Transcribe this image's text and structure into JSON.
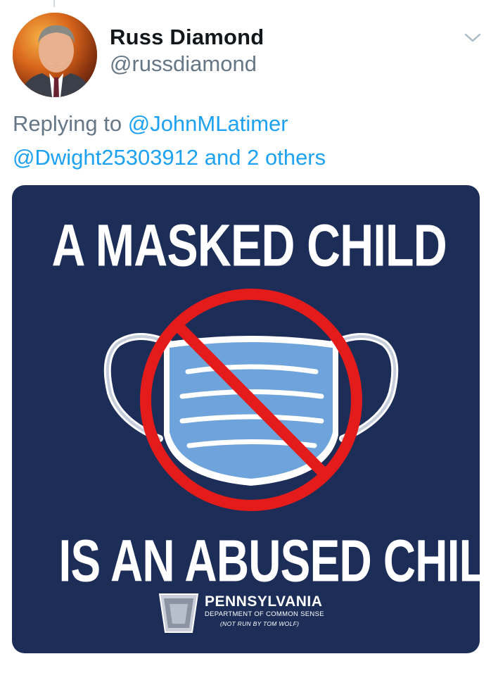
{
  "tweet": {
    "author": {
      "name": "Russ Diamond",
      "handle": "@russdiamond",
      "avatar_icon": "profile-photo"
    },
    "menu_icon": "chevron-down-icon",
    "reply": {
      "prefix": "Replying to",
      "mention_1": "@JohnMLatimer",
      "mention_2": "@Dwight25303912",
      "others": "and 2 others"
    },
    "media": {
      "headline_top": "A MASKED CHILD",
      "headline_bottom": "IS AN ABUSED CHILD",
      "graphic_icon": "no-mask-prohibition-icon",
      "logo": {
        "title": "PENNSYLVANIA",
        "subtitle": "DEPARTMENT OF COMMON SENSE",
        "note": "(NOT RUN BY TOM WOLF)",
        "icon": "keystone-icon"
      },
      "colors": {
        "background": "#1c2d57",
        "prohibition": "#e31b1b",
        "mask": "#6fa3dc",
        "text": "#ffffff"
      }
    },
    "colors": {
      "link": "#1da1f2",
      "muted": "#657786",
      "name": "#14171a"
    }
  }
}
